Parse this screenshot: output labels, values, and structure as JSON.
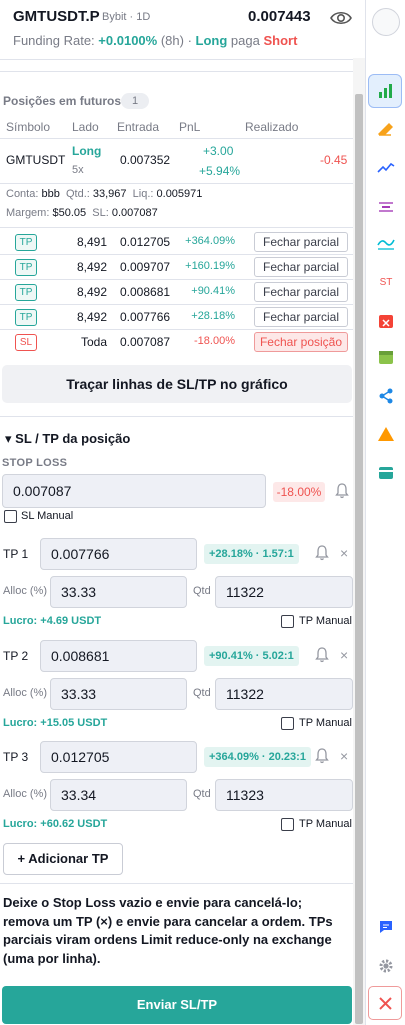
{
  "header": {
    "symbol": "GMTUSDT.P",
    "exchange": "Bybit · 1D",
    "price": "0.007443",
    "funding_label": "Funding Rate:",
    "funding_rate": "+0.0100%",
    "funding_period": "(8h) ·",
    "long": "Long",
    "pays": "paga",
    "short": "Short"
  },
  "positions": {
    "title": "Posições em futuros",
    "count": "1",
    "columns": [
      "Símbolo",
      "Lado",
      "Entrada",
      "PnL",
      "Realizado"
    ],
    "row": {
      "symbol": "GMTUSDT",
      "side": "Long",
      "leverage": "5x",
      "entry": "0.007352",
      "pnl": "+3.00",
      "pnl_pct": "+5.94%",
      "realized": "-0.45"
    },
    "info1": {
      "account_label": "Conta:",
      "account": "bbb",
      "qty_label": "Qtd.:",
      "qty": "33,967",
      "liq_label": "Liq.:",
      "liq": "0.005971"
    },
    "info2": {
      "margin_label": "Margem:",
      "margin": "$50.05",
      "sl_label": "SL:",
      "sl": "0.007087"
    },
    "orders": [
      {
        "tag": "TP",
        "qty": "8,491",
        "price": "0.012705",
        "pct": "+364.09%",
        "action": "Fechar parcial"
      },
      {
        "tag": "TP",
        "qty": "8,492",
        "price": "0.009707",
        "pct": "+160.19%",
        "action": "Fechar parcial"
      },
      {
        "tag": "TP",
        "qty": "8,492",
        "price": "0.008681",
        "pct": "+90.41%",
        "action": "Fechar parcial"
      },
      {
        "tag": "TP",
        "qty": "8,492",
        "price": "0.007766",
        "pct": "+28.18%",
        "action": "Fechar parcial"
      },
      {
        "tag": "SL",
        "qty": "Toda",
        "price": "0.007087",
        "pct": "-18.00%",
        "action": "Fechar posição"
      }
    ]
  },
  "draw_lines_button": "Traçar linhas de SL/TP no gráfico",
  "sltp": {
    "title": "SL / TP da posição",
    "stop_loss_label": "STOP LOSS",
    "stop_loss_value": "0.007087",
    "stop_loss_pct": "-18.00%",
    "sl_manual_label": "SL Manual",
    "alloc_label": "Alloc (%)",
    "qty_label": "Qtd",
    "tp_manual_label": "TP Manual",
    "tps": [
      {
        "label": "TP 1",
        "price": "0.007766",
        "badge": "+28.18% · 1.57:1",
        "alloc": "33.33",
        "qty": "11322",
        "profit": "Lucro: +4.69 USDT"
      },
      {
        "label": "TP 2",
        "price": "0.008681",
        "badge": "+90.41% · 5.02:1",
        "alloc": "33.33",
        "qty": "11322",
        "profit": "Lucro: +15.05 USDT"
      },
      {
        "label": "TP 3",
        "price": "0.012705",
        "badge": "+364.09% · 20.23:1",
        "alloc": "33.34",
        "qty": "11323",
        "profit": "Lucro: +60.62 USDT"
      }
    ],
    "add_tp_button": "+ Adicionar TP",
    "help_text": "Deixe o Stop Loss vazio e envie para cancelá-lo; remova um TP (×) e envie para cancelar a ordem. TPs parciais viram ordens Limit reduce-only na exchange (uma por linha).",
    "submit_button": "Enviar SL/TP"
  },
  "rail": {
    "st_label": "ST",
    "icons": [
      "chart-bars-icon",
      "pencil-icon",
      "trend-icon",
      "levels-icon",
      "wave-icon",
      "st-icon",
      "calendar-x-icon",
      "calendar-icon",
      "share-icon",
      "warning-icon",
      "card-icon",
      "chat-icon",
      "gear-icon",
      "close-icon"
    ]
  },
  "colors": {
    "green": "#26a69a",
    "red": "#ef5350",
    "blue": "#2962ff",
    "accent_button": "#26a69a"
  }
}
